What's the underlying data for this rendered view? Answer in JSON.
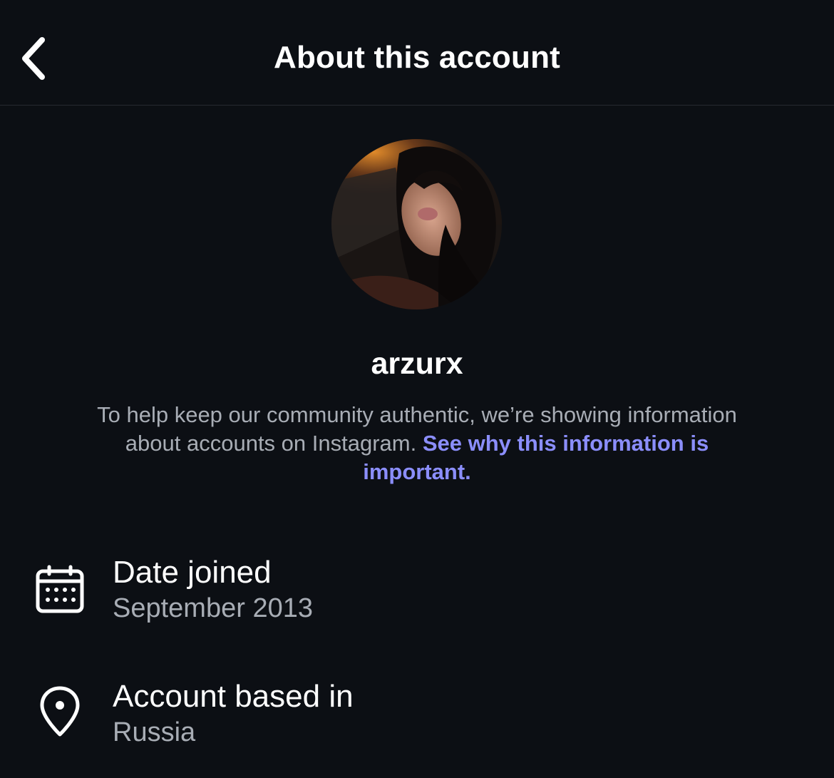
{
  "header": {
    "title": "About this account",
    "back_icon": "chevron-left-icon"
  },
  "profile": {
    "username": "arzurx",
    "avatar": "profile-photo"
  },
  "description": {
    "text": "To help keep our community authentic, we’re showing information about accounts on Instagram. ",
    "link_text": "See why this information is important."
  },
  "details": [
    {
      "icon": "calendar-icon",
      "label": "Date joined",
      "value": "September 2013"
    },
    {
      "icon": "location-pin-icon",
      "label": "Account based in",
      "value": "Russia"
    }
  ],
  "colors": {
    "background": "#0c0f14",
    "primary_text": "#ffffff",
    "secondary_text": "#a8adb5",
    "link": "#8b8efc"
  }
}
